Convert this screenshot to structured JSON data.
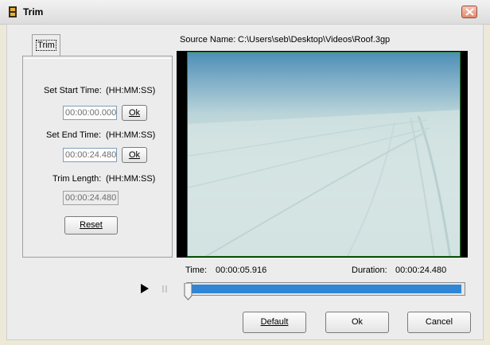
{
  "window": {
    "title": "Trim",
    "close_label": "✕"
  },
  "tabs": [
    {
      "label": "Trim",
      "selected": true
    }
  ],
  "source": {
    "label": "Source Name:",
    "value": "C:\\Users\\seb\\Desktop\\Videos\\Roof.3gp"
  },
  "trim_panel": {
    "start_label": "Set Start Time:",
    "start_format": "(HH:MM:SS)",
    "start_value": "00:00:00.000",
    "start_ok": "Ok",
    "end_label": "Set End Time:",
    "end_format": "(HH:MM:SS)",
    "end_value": "00:00:24.480",
    "end_ok": "Ok",
    "length_label": "Trim Length:",
    "length_format": "(HH:MM:SS)",
    "length_value": "00:00:24.480",
    "reset": "Reset"
  },
  "playback": {
    "time_label": "Time:",
    "time_value": "00:00:05.916",
    "duration_label": "Duration:",
    "duration_value": "00:00:24.480",
    "play_icon": "play-icon",
    "pause_icon": "pause-icon",
    "selection_start": 0.0,
    "selection_end": 1.0
  },
  "footer": {
    "default": "Default",
    "ok": "Ok",
    "cancel": "Cancel"
  },
  "colors": {
    "accent": "#2f86d6",
    "video_border": "#1e7d1e"
  }
}
